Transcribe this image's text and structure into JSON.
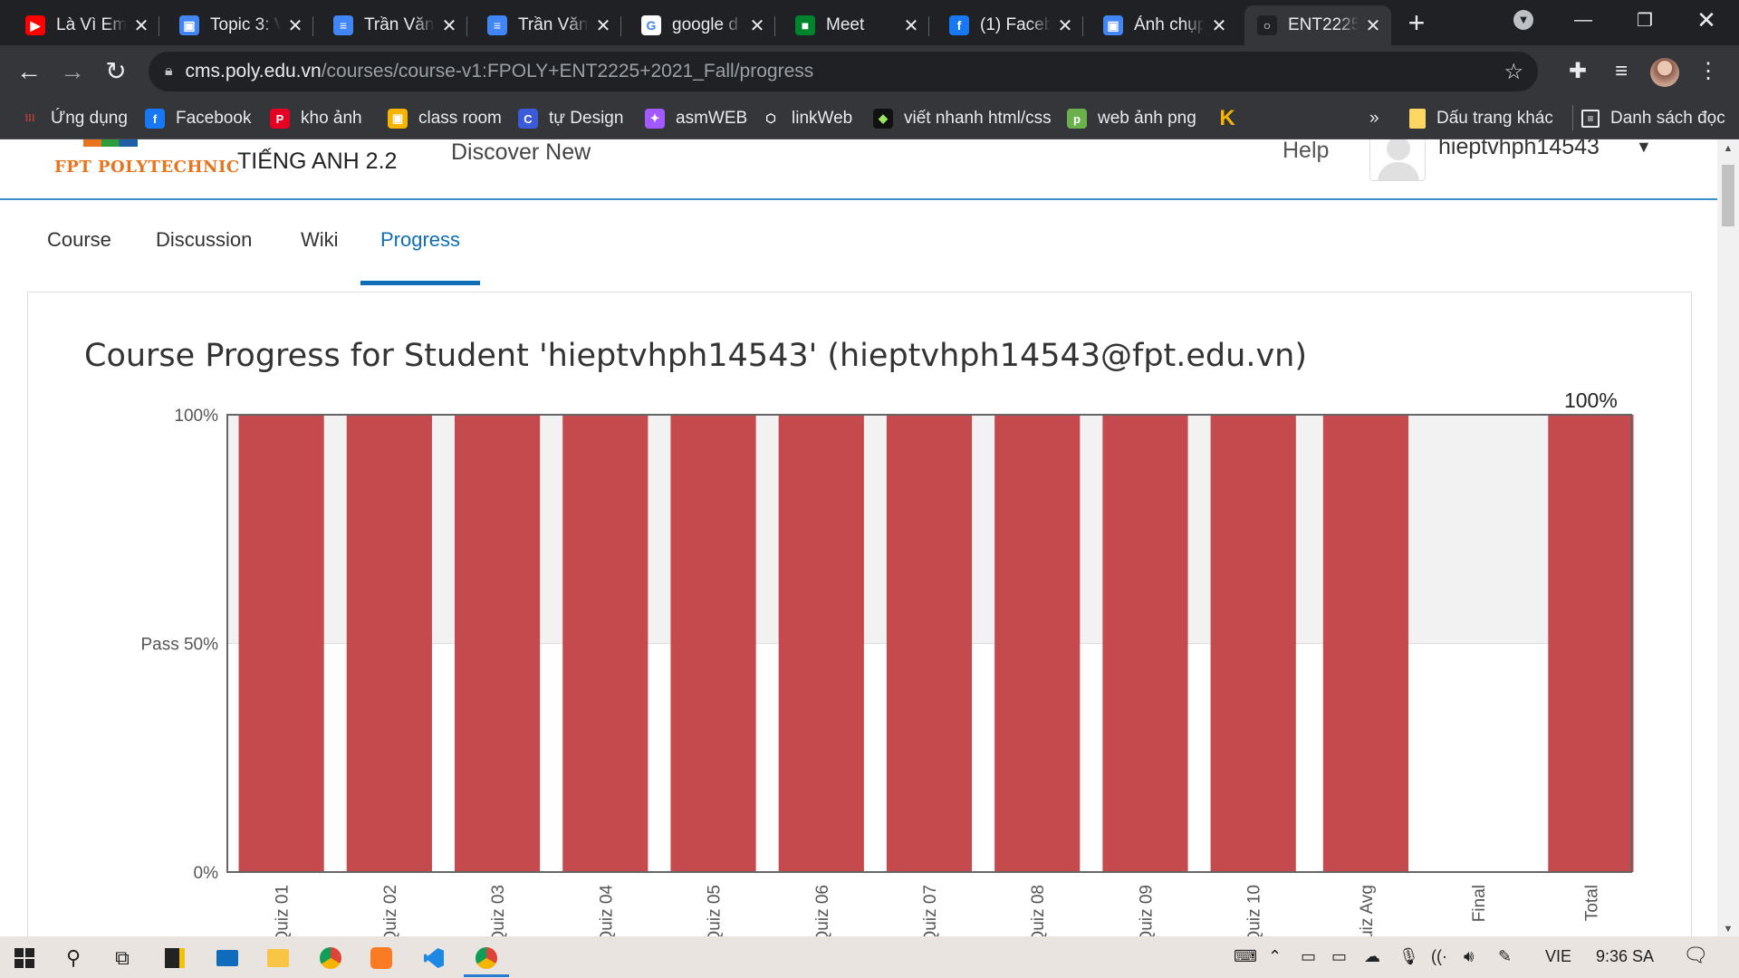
{
  "browser": {
    "tabs": [
      {
        "title": "Là Vì Em",
        "icon": "youtube-icon",
        "color": "#ff0000",
        "glyph": "▶"
      },
      {
        "title": "Topic 3: V",
        "icon": "classroom-icon",
        "color": "#4285f4",
        "glyph": "▣"
      },
      {
        "title": "Trần Văn",
        "icon": "docs-icon",
        "color": "#4285f4",
        "glyph": "≡"
      },
      {
        "title": "Trần Văn",
        "icon": "docs-icon",
        "color": "#4285f4",
        "glyph": "≡"
      },
      {
        "title": "google d",
        "icon": "google-icon",
        "color": "#ffffff",
        "glyph": "G"
      },
      {
        "title": "Meet",
        "icon": "meet-icon",
        "color": "#00832d",
        "glyph": "■"
      },
      {
        "title": "(1) Faceb",
        "icon": "facebook-icon",
        "color": "#1877f2",
        "glyph": "f"
      },
      {
        "title": "Ảnh chụp",
        "icon": "photo-icon",
        "color": "#4285f4",
        "glyph": "▣"
      },
      {
        "title": "ENT2225",
        "icon": "loading-icon",
        "color": "#202124",
        "glyph": "○"
      }
    ],
    "url_host": "cms.poly.edu.vn",
    "url_path": "/courses/course-v1:FPOLY+ENT2225+2021_Fall/progress",
    "bookmarks": [
      {
        "label": "Ứng dụng",
        "icon": "apps-grid-icon",
        "color": "#35363a",
        "glyph": "⁞⁞⁞"
      },
      {
        "label": "Facebook",
        "icon": "facebook-icon",
        "color": "#1877f2",
        "glyph": "f"
      },
      {
        "label": "kho ảnh",
        "icon": "pinterest-icon",
        "color": "#e60023",
        "glyph": "P"
      },
      {
        "label": "class room",
        "icon": "classroom-icon",
        "color": "#f4b400",
        "glyph": "▣"
      },
      {
        "label": "tự Design",
        "icon": "canva-icon",
        "color": "#3b5bdb",
        "glyph": "C"
      },
      {
        "label": "asmWEB",
        "icon": "figma-icon",
        "color": "#a259ff",
        "glyph": "✦"
      },
      {
        "label": "linkWeb",
        "icon": "cube-icon",
        "color": "#35363a",
        "glyph": "⬡"
      },
      {
        "label": "viết nhanh html/css",
        "icon": "emmet-icon",
        "color": "#111111",
        "glyph": "◆"
      },
      {
        "label": "web ảnh png",
        "icon": "pngtree-icon",
        "color": "#6ab04c",
        "glyph": "p"
      },
      {
        "label": "",
        "icon": "k-logo-icon",
        "color": "#35363a",
        "glyph": "K"
      }
    ],
    "more_bookmarks": "»",
    "other_bookmarks": "Dấu trang khác",
    "reading_list": "Danh sách đọc"
  },
  "site": {
    "logo_text": "FPT POLYTECHNIC",
    "course_name": "TIẾNG ANH 2.2",
    "discover": "Discover New",
    "help": "Help",
    "username": "hieptvhph14543"
  },
  "course_tabs": [
    {
      "label": "Course",
      "active": false
    },
    {
      "label": "Discussion",
      "active": false
    },
    {
      "label": "Wiki",
      "active": false
    },
    {
      "label": "Progress",
      "active": true
    }
  ],
  "progress_title": "Course Progress for Student 'hieptvhph14543' (hieptvhph14543@fpt.edu.vn)",
  "chart_data": {
    "type": "bar",
    "categories": [
      "Quiz 01",
      "Quiz 02",
      "Quiz 03",
      "Quiz 04",
      "Quiz 05",
      "Quiz 06",
      "Quiz 07",
      "Quiz 08",
      "Quiz 09",
      "Quiz 10",
      "Quiz Avg",
      "Final",
      "Total"
    ],
    "values": [
      100,
      100,
      100,
      100,
      100,
      100,
      100,
      100,
      100,
      100,
      100,
      0,
      100
    ],
    "ylim": [
      0,
      100
    ],
    "y_ticks": [
      {
        "value": 100,
        "label": "100%"
      },
      {
        "value": 50,
        "label": "Pass 50%"
      },
      {
        "value": 0,
        "label": "0%"
      }
    ],
    "pass_threshold": 50,
    "data_labels": [
      {
        "category": "Total",
        "label": "100%"
      }
    ],
    "bar_color": "#c44a4d",
    "pass_band_color": "#f2f2f2",
    "x_label_rotation": "vertical"
  },
  "taskbar": {
    "apps": [
      "windows-start-icon",
      "search-icon",
      "task-view-icon",
      "sticky-notes-icon",
      "mail-icon",
      "file-explorer-icon",
      "chrome-icon",
      "xampp-icon",
      "vscode-icon",
      "chrome-active-icon"
    ],
    "language": "VIE",
    "time": "9:36 SA"
  }
}
